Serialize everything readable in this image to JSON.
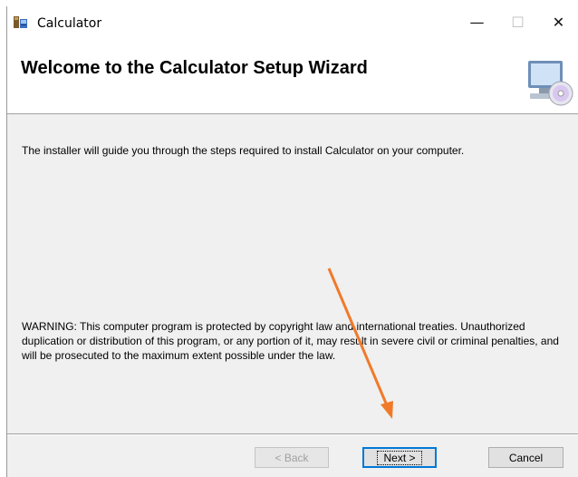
{
  "window": {
    "title": "Calculator",
    "controls": {
      "minimize": "—",
      "maximize": "☐",
      "close": "✕"
    }
  },
  "header": {
    "title": "Welcome to the Calculator Setup Wizard",
    "icon": "computer-cd-icon"
  },
  "body": {
    "intro": "The installer will guide you through the steps required to install Calculator on your computer.",
    "warning": "WARNING: This computer program is protected by copyright law and international treaties. Unauthorized duplication or distribution of this program, or any portion of it, may result in severe civil or criminal penalties, and will be prosecuted to the maximum extent possible under the law."
  },
  "buttons": {
    "back": "< Back",
    "next": "Next >",
    "cancel": "Cancel"
  },
  "annotation": {
    "arrow_color": "#f07a2a",
    "points_to": "next-button"
  }
}
